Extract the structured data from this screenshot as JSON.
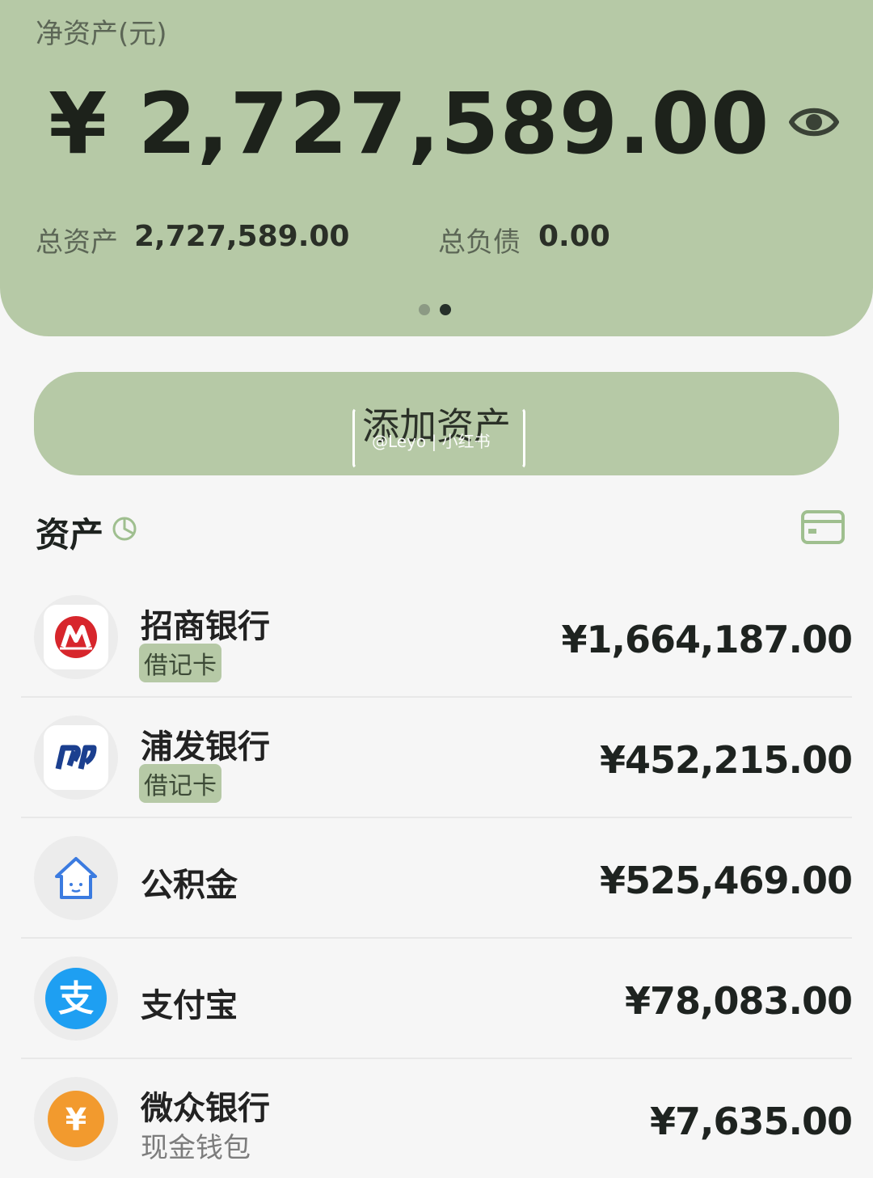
{
  "hero": {
    "title": "净资产(元)",
    "amount": "¥ 2,727,589.00",
    "total_assets_label": "总资产",
    "total_assets_value": "2,727,589.00",
    "total_liabilities_label": "总负债",
    "total_liabilities_value": "0.00",
    "visibility_icon": "eye-icon",
    "page_indicator": {
      "count": 2,
      "active": 2
    }
  },
  "add_button": {
    "label": "添加资产",
    "watermark": "@Leyo | 小红书"
  },
  "assets_section": {
    "title": "资产",
    "title_icon": "pie-chart-icon",
    "action_icon": "card-icon"
  },
  "accounts": [
    {
      "name": "招商银行",
      "tag": "借记卡",
      "amount": "¥1,664,187.00",
      "logo": "cmb-logo",
      "logo_color": "#d7262c"
    },
    {
      "name": "浦发银行",
      "tag": "借记卡",
      "amount": "¥452,215.00",
      "logo": "spdb-logo",
      "logo_color": "#1b3f8f"
    },
    {
      "name": "公积金",
      "amount": "¥525,469.00",
      "logo": "house-icon",
      "logo_color": "#3b7be0"
    },
    {
      "name": "支付宝",
      "amount": "¥78,083.00",
      "logo": "alipay-logo",
      "logo_color": "#1e9ff2"
    },
    {
      "name": "微众银行",
      "subtext": "现金钱包",
      "amount": "¥7,635.00",
      "logo": "yuan-coin-icon",
      "logo_color": "#f29a2e"
    }
  ],
  "colors": {
    "accent": "#b6c9a6",
    "background": "#f6f6f6"
  }
}
